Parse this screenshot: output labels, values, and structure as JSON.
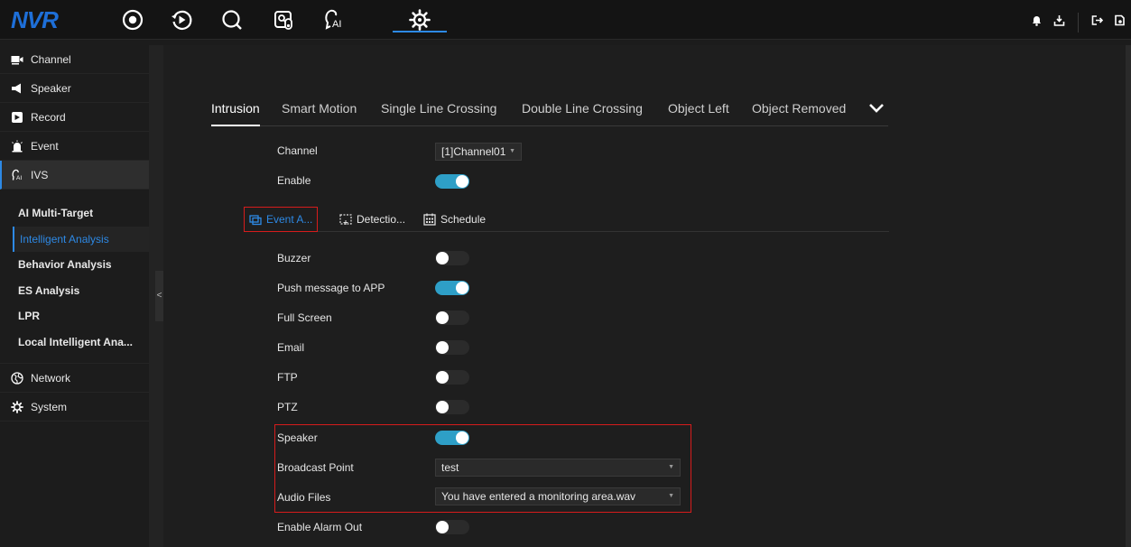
{
  "app": {
    "logo": "NVR"
  },
  "topnav": [
    {
      "name": "live-view-icon"
    },
    {
      "name": "playback-icon"
    },
    {
      "name": "search-icon"
    },
    {
      "name": "smart-search-icon"
    },
    {
      "name": "ai-icon"
    },
    {
      "name": "settings-icon",
      "active": true
    }
  ],
  "sidebar": {
    "items": [
      {
        "label": "Channel",
        "icon": "camera-icon"
      },
      {
        "label": "Speaker",
        "icon": "speaker-icon"
      },
      {
        "label": "Record",
        "icon": "record-icon"
      },
      {
        "label": "Event",
        "icon": "alarm-icon"
      },
      {
        "label": "IVS",
        "icon": "ai-icon"
      }
    ],
    "sub": [
      {
        "label": "AI Multi-Target"
      },
      {
        "label": "Intelligent Analysis"
      },
      {
        "label": "Behavior Analysis"
      },
      {
        "label": "ES Analysis"
      },
      {
        "label": "LPR"
      },
      {
        "label": "Local Intelligent Ana..."
      }
    ],
    "bottom": [
      {
        "label": "Network",
        "icon": "network-icon"
      },
      {
        "label": "System",
        "icon": "system-icon"
      }
    ],
    "collapse_label": "<"
  },
  "tabs": [
    "Intrusion",
    "Smart Motion",
    "Single Line Crossing",
    "Double Line Crossing",
    "Object Left",
    "Object Removed"
  ],
  "form": {
    "channel_label": "Channel",
    "channel_value": "[1]Channel01",
    "enable_label": "Enable"
  },
  "subtabs": [
    "Event A...",
    "Detectio...",
    "Schedule"
  ],
  "actions": [
    {
      "label": "Buzzer",
      "on": false
    },
    {
      "label": "Push message to APP",
      "on": true
    },
    {
      "label": "Full Screen",
      "on": false
    },
    {
      "label": "Email",
      "on": false
    },
    {
      "label": "FTP",
      "on": false
    },
    {
      "label": "PTZ",
      "on": false
    },
    {
      "label": "Speaker",
      "on": true
    }
  ],
  "broadcast": {
    "label": "Broadcast Point",
    "value": "test"
  },
  "audio": {
    "label": "Audio Files",
    "value": "You have entered a monitoring area.wav"
  },
  "alarm_out": {
    "label": "Enable Alarm Out",
    "on": false
  }
}
